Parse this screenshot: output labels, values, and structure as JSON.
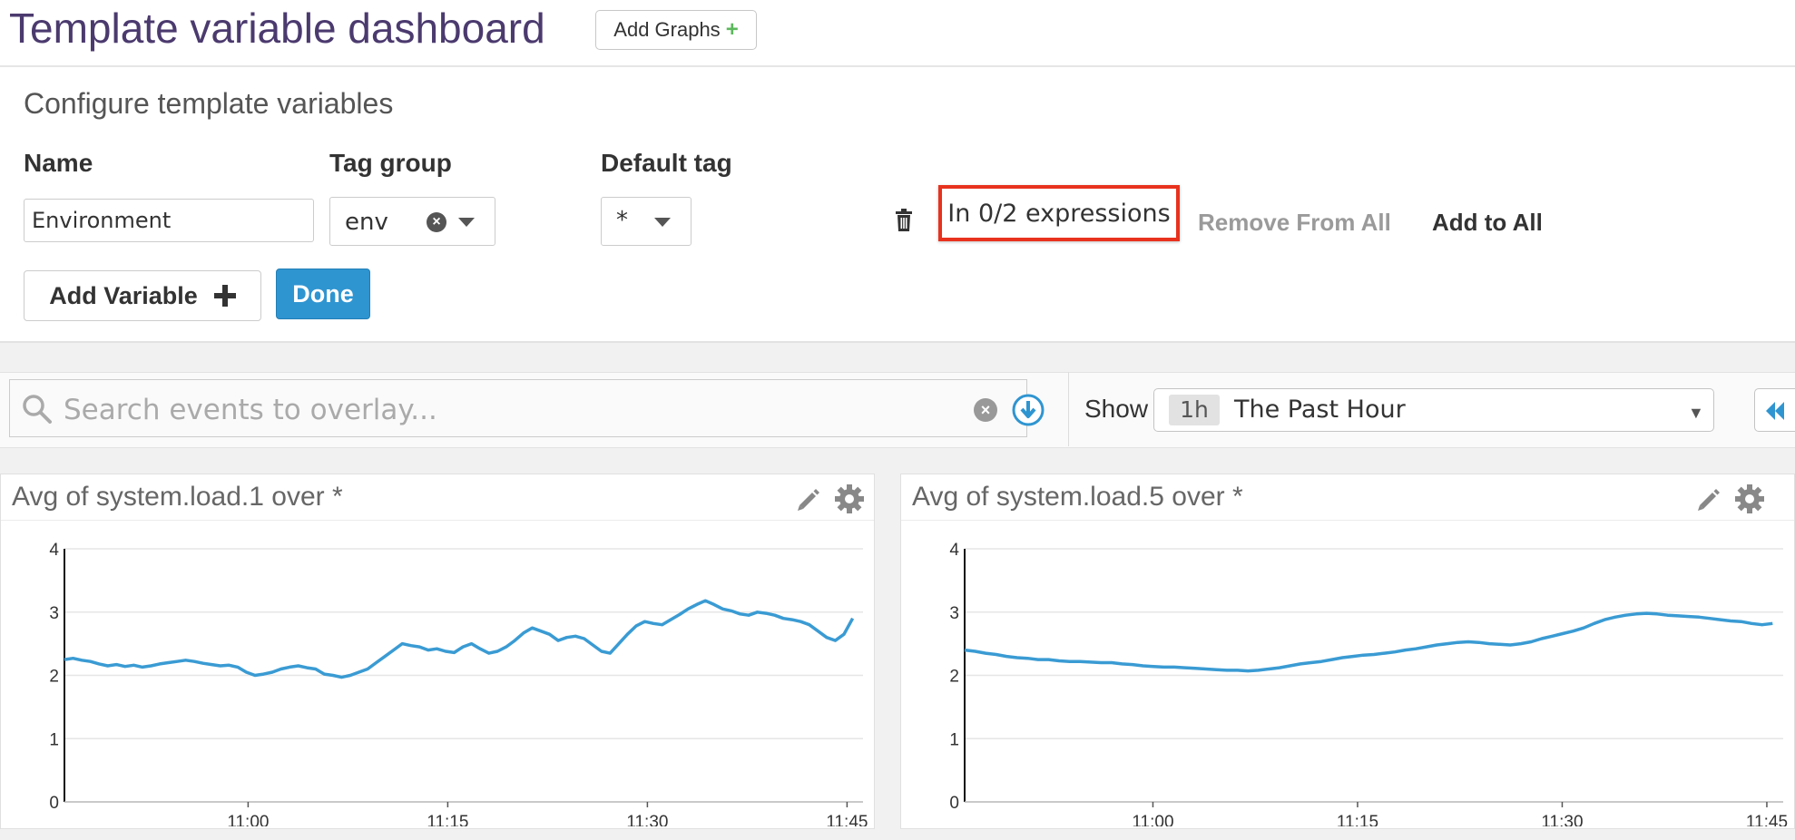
{
  "header": {
    "title": "Template variable dashboard",
    "add_graphs_label": "Add Graphs",
    "add_graphs_plus": "+"
  },
  "config": {
    "title": "Configure template variables",
    "columns": {
      "name": "Name",
      "tag_group": "Tag group",
      "default_tag": "Default tag"
    },
    "variable": {
      "name_value": "Environment",
      "tag_group_value": "env",
      "default_tag_value": "*",
      "expressions_text": "In 0/2 expressions",
      "remove_from_all": "Remove From All",
      "add_to_all": "Add to All"
    },
    "add_variable_label": "Add Variable",
    "done_label": "Done"
  },
  "toolbar": {
    "search_placeholder": "Search events to overlay...",
    "show_label": "Show",
    "time_badge": "1h",
    "time_label": "The Past Hour"
  },
  "graphs": [
    {
      "title": "Avg of system.load.1 over *"
    },
    {
      "title": "Avg of system.load.5 over *"
    }
  ],
  "colors": {
    "line": "#3a9bd3",
    "accent": "#2f95d1",
    "highlight": "#e8321e",
    "title": "#4b3a6e"
  },
  "chart_data": [
    {
      "type": "line",
      "title": "Avg of system.load.1 over *",
      "ylim": [
        0,
        4
      ],
      "yticks": [
        "0",
        "1",
        "2",
        "3",
        "4"
      ],
      "xticks": [
        {
          "t": 11.0,
          "label": "11:00"
        },
        {
          "t": 11.25,
          "label": "11:15"
        },
        {
          "t": 11.5,
          "label": "11:30"
        },
        {
          "t": 11.75,
          "label": "11:45"
        }
      ],
      "xlim": [
        10.77,
        11.77
      ],
      "grid": true,
      "series": [
        {
          "x_start": 10.77,
          "x_end": 11.757,
          "values": [
            2.25,
            2.27,
            2.24,
            2.22,
            2.18,
            2.15,
            2.17,
            2.14,
            2.16,
            2.13,
            2.15,
            2.18,
            2.2,
            2.22,
            2.24,
            2.22,
            2.19,
            2.17,
            2.15,
            2.16,
            2.13,
            2.05,
            2.0,
            2.02,
            2.05,
            2.1,
            2.13,
            2.15,
            2.12,
            2.1,
            2.02,
            2.0,
            1.97,
            2.0,
            2.05,
            2.1,
            2.2,
            2.3,
            2.4,
            2.5,
            2.47,
            2.45,
            2.4,
            2.42,
            2.38,
            2.36,
            2.45,
            2.5,
            2.42,
            2.35,
            2.38,
            2.45,
            2.55,
            2.67,
            2.75,
            2.7,
            2.65,
            2.55,
            2.6,
            2.62,
            2.58,
            2.48,
            2.38,
            2.35,
            2.5,
            2.65,
            2.78,
            2.85,
            2.82,
            2.8,
            2.88,
            2.96,
            3.05,
            3.12,
            3.18,
            3.12,
            3.05,
            3.02,
            2.97,
            2.95,
            3.0,
            2.98,
            2.95,
            2.9,
            2.88,
            2.85,
            2.8,
            2.7,
            2.6,
            2.55,
            2.65,
            2.9
          ]
        }
      ]
    },
    {
      "type": "line",
      "title": "Avg of system.load.5 over *",
      "ylim": [
        0,
        4
      ],
      "yticks": [
        "0",
        "1",
        "2",
        "3",
        "4"
      ],
      "xticks": [
        {
          "t": 11.0,
          "label": "11:00"
        },
        {
          "t": 11.25,
          "label": "11:15"
        },
        {
          "t": 11.5,
          "label": "11:30"
        },
        {
          "t": 11.75,
          "label": "11:45"
        }
      ],
      "xlim": [
        10.77,
        11.77
      ],
      "grid": true,
      "series": [
        {
          "x_start": 10.77,
          "x_end": 11.757,
          "values": [
            2.4,
            2.38,
            2.35,
            2.33,
            2.3,
            2.28,
            2.27,
            2.25,
            2.25,
            2.23,
            2.22,
            2.22,
            2.21,
            2.2,
            2.2,
            2.18,
            2.17,
            2.15,
            2.14,
            2.13,
            2.13,
            2.12,
            2.11,
            2.1,
            2.09,
            2.08,
            2.08,
            2.07,
            2.08,
            2.1,
            2.12,
            2.15,
            2.18,
            2.2,
            2.22,
            2.25,
            2.28,
            2.3,
            2.32,
            2.33,
            2.35,
            2.37,
            2.4,
            2.42,
            2.45,
            2.48,
            2.5,
            2.52,
            2.53,
            2.52,
            2.5,
            2.49,
            2.48,
            2.5,
            2.53,
            2.58,
            2.62,
            2.66,
            2.7,
            2.75,
            2.82,
            2.88,
            2.92,
            2.95,
            2.97,
            2.98,
            2.97,
            2.95,
            2.94,
            2.93,
            2.92,
            2.9,
            2.88,
            2.86,
            2.85,
            2.82,
            2.8,
            2.82
          ]
        }
      ]
    }
  ]
}
